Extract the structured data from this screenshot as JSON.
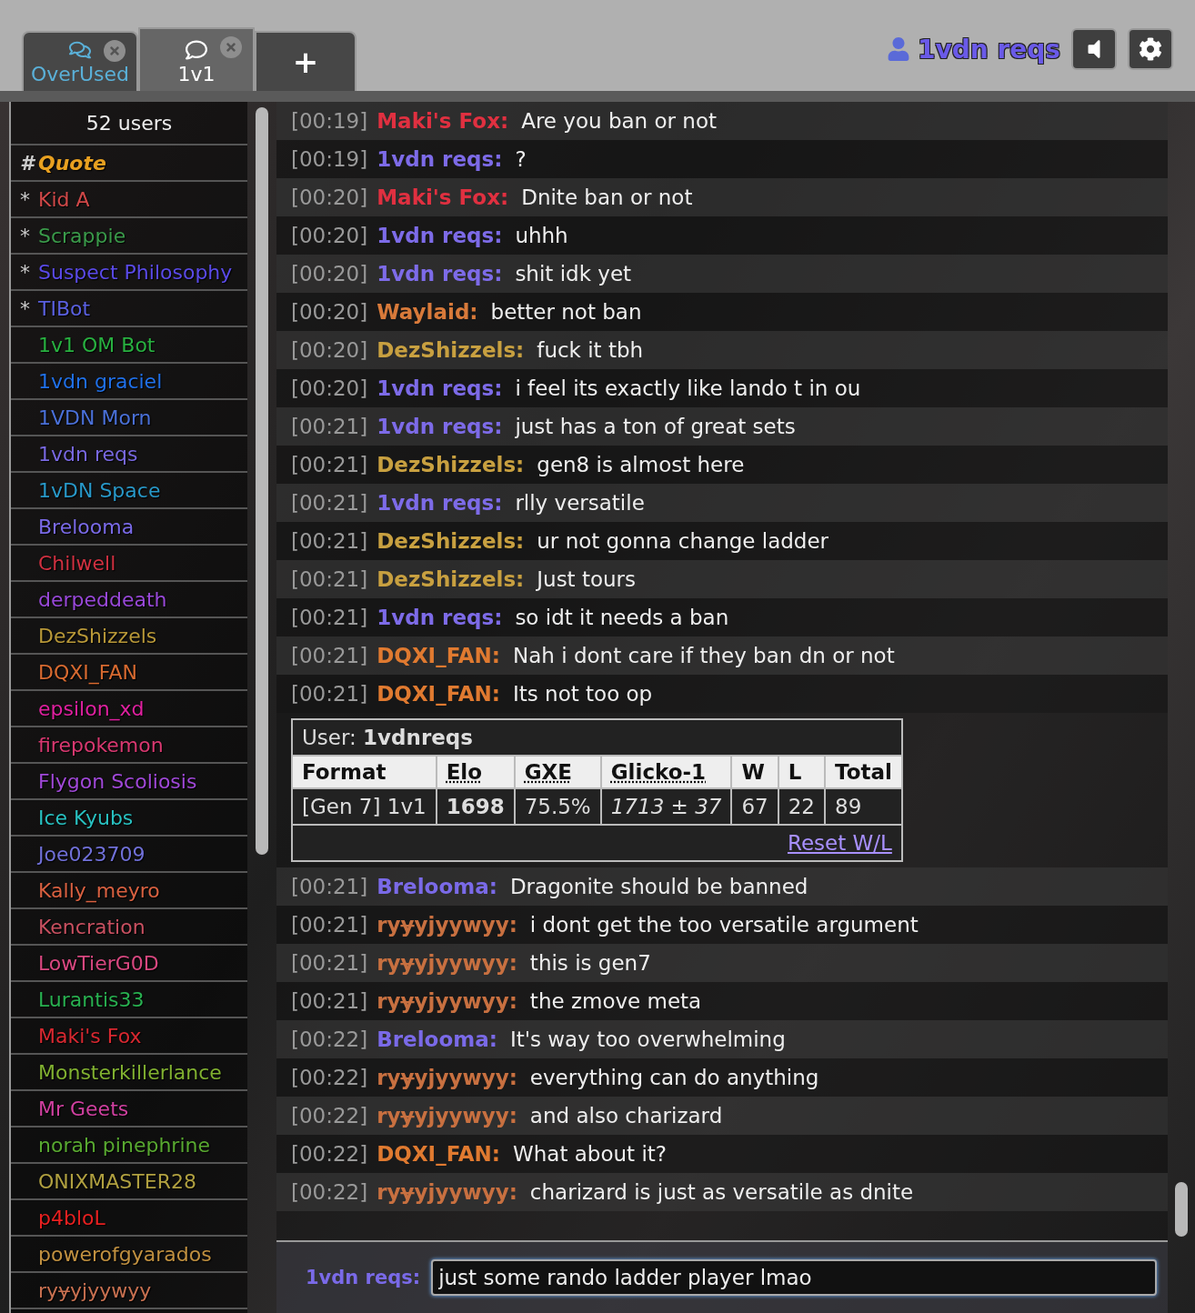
{
  "tabs": [
    {
      "label": "OverUsed",
      "selected": false
    },
    {
      "label": "1v1",
      "selected": true
    }
  ],
  "new_tab": {
    "label": "+"
  },
  "header": {
    "user": "1vdn reqs"
  },
  "userlist": {
    "count": "52 users",
    "users": [
      {
        "symbol": "#",
        "name": "Quote",
        "color": "#e8a020",
        "italic": true
      },
      {
        "symbol": "*",
        "name": "Kid A",
        "color": "#d04848",
        "italic": false
      },
      {
        "symbol": "*",
        "name": "Scrappie",
        "color": "#3a9a4a",
        "italic": false
      },
      {
        "symbol": "*",
        "name": "Suspect Philosophy",
        "color": "#5a4ae8",
        "italic": false
      },
      {
        "symbol": "*",
        "name": "TIBot",
        "color": "#5a60e0",
        "italic": false
      },
      {
        "name": "1v1 OM Bot",
        "color": "#28b040",
        "italic": false
      },
      {
        "name": "1vdn graciel",
        "color": "#2070e8",
        "italic": false
      },
      {
        "name": "1VDN Morn",
        "color": "#4a70d8",
        "italic": false
      },
      {
        "name": "1vdn reqs",
        "color": "#7868e0",
        "italic": false
      },
      {
        "name": "1vDN Space",
        "color": "#2898c8",
        "italic": false
      },
      {
        "name": "Brelooma",
        "color": "#7a6ae8",
        "italic": false
      },
      {
        "name": "Chilwell",
        "color": "#d03040",
        "italic": false
      },
      {
        "name": "derpeddeath",
        "color": "#9848d8",
        "italic": false
      },
      {
        "name": "DezShizzels",
        "color": "#b89838",
        "italic": false
      },
      {
        "name": "DQXI_FAN",
        "color": "#d86a30",
        "italic": false
      },
      {
        "name": "epsilon_xd",
        "color": "#e020a0",
        "italic": false
      },
      {
        "name": "firepokemon",
        "color": "#d83870",
        "italic": false
      },
      {
        "name": "Flygon Scoliosis",
        "color": "#a048d8",
        "italic": false
      },
      {
        "name": "Ice Kyubs",
        "color": "#28c0c0",
        "italic": false
      },
      {
        "name": "Joe023709",
        "color": "#7070d8",
        "italic": false
      },
      {
        "name": "Kally_meyro",
        "color": "#d86040",
        "italic": false
      },
      {
        "name": "Kencration",
        "color": "#c85060",
        "italic": false
      },
      {
        "name": "LowTierG0D",
        "color": "#d84880",
        "italic": false
      },
      {
        "name": "Lurantis33",
        "color": "#28b050",
        "italic": false
      },
      {
        "name": "Maki's Fox",
        "color": "#d82830",
        "italic": false
      },
      {
        "name": "Monsterkillerlance",
        "color": "#80b030",
        "italic": false
      },
      {
        "name": "Mr Geets",
        "color": "#d040a0",
        "italic": false
      },
      {
        "name": "norah pinephrine",
        "color": "#58a830",
        "italic": false
      },
      {
        "name": "ONIXMASTER28",
        "color": "#b0a040",
        "italic": false
      },
      {
        "name": "p4bloL",
        "color": "#e82020",
        "italic": false
      },
      {
        "name": "powerofgyarados",
        "color": "#c09040",
        "italic": false
      },
      {
        "name": "ryɏyjyywyy",
        "color": "#c87050",
        "italic": false
      }
    ]
  },
  "chat": [
    {
      "kind": "message",
      "time": "[00:19]",
      "name": "Maki's Fox:",
      "color": "#e03040",
      "text": "Are you ban or not"
    },
    {
      "kind": "message",
      "time": "[00:19]",
      "name": "1vdn reqs:",
      "color": "#7d6be8",
      "text": "?"
    },
    {
      "kind": "message",
      "time": "[00:20]",
      "name": "Maki's Fox:",
      "color": "#e03040",
      "text": "Dnite ban or not"
    },
    {
      "kind": "message",
      "time": "[00:20]",
      "name": "1vdn reqs:",
      "color": "#7d6be8",
      "text": "uhhh"
    },
    {
      "kind": "message",
      "time": "[00:20]",
      "name": "1vdn reqs:",
      "color": "#7d6be8",
      "text": "shit idk yet"
    },
    {
      "kind": "message",
      "time": "[00:20]",
      "name": "Waylaid:",
      "color": "#d87a3a",
      "text": "better not ban"
    },
    {
      "kind": "message",
      "time": "[00:20]",
      "name": "DezShizzels:",
      "color": "#c8a040",
      "text": "fuck it tbh"
    },
    {
      "kind": "message",
      "time": "[00:20]",
      "name": "1vdn reqs:",
      "color": "#7d6be8",
      "text": "i feel its exactly like lando t in ou"
    },
    {
      "kind": "message",
      "time": "[00:21]",
      "name": "1vdn reqs:",
      "color": "#7d6be8",
      "text": "just has a ton of great sets"
    },
    {
      "kind": "message",
      "time": "[00:21]",
      "name": "DezShizzels:",
      "color": "#c8a040",
      "text": "gen8 is almost here"
    },
    {
      "kind": "message",
      "time": "[00:21]",
      "name": "1vdn reqs:",
      "color": "#7d6be8",
      "text": "rlly versatile"
    },
    {
      "kind": "message",
      "time": "[00:21]",
      "name": "DezShizzels:",
      "color": "#c8a040",
      "text": "ur not gonna change ladder"
    },
    {
      "kind": "message",
      "time": "[00:21]",
      "name": "DezShizzels:",
      "color": "#c8a040",
      "text": "Just tours"
    },
    {
      "kind": "message",
      "time": "[00:21]",
      "name": "1vdn reqs:",
      "color": "#7d6be8",
      "text": "so idt it needs a ban"
    },
    {
      "kind": "message",
      "time": "[00:21]",
      "name": "DQXI_FAN:",
      "color": "#e07a30",
      "text": "Nah i dont care if they ban dn or not"
    },
    {
      "kind": "message",
      "time": "[00:21]",
      "name": "DQXI_FAN:",
      "color": "#e07a30",
      "text": "Its not too op"
    },
    {
      "kind": "rank_table",
      "user_label": "User:",
      "user": "1vdnreqs",
      "columns": [
        {
          "label": "Format",
          "dotted": false
        },
        {
          "label": "Elo",
          "dotted": true
        },
        {
          "label": "GXE",
          "dotted": true
        },
        {
          "label": "Glicko-1",
          "dotted": true
        },
        {
          "label": "W",
          "dotted": false
        },
        {
          "label": "L",
          "dotted": false
        },
        {
          "label": "Total",
          "dotted": false
        }
      ],
      "cells": [
        "[Gen 7] 1v1",
        "1698",
        "75.5%",
        "1713 ± 37",
        "67",
        "22",
        "89"
      ],
      "link": "Reset W/L"
    },
    {
      "kind": "message",
      "time": "[00:21]",
      "name": "Brelooma:",
      "color": "#7a6ae8",
      "text": "Dragonite should be banned"
    },
    {
      "kind": "message",
      "time": "[00:21]",
      "name": "ryɏyjyywyy:",
      "color": "#c87040",
      "text": "i dont get the too versatile argument"
    },
    {
      "kind": "message",
      "time": "[00:21]",
      "name": "ryɏyjyywyy:",
      "color": "#c87040",
      "text": "this is gen7"
    },
    {
      "kind": "message",
      "time": "[00:21]",
      "name": "ryɏyjyywyy:",
      "color": "#c87040",
      "text": "the zmove meta"
    },
    {
      "kind": "message",
      "time": "[00:22]",
      "name": "Brelooma:",
      "color": "#7a6ae8",
      "text": "It's way too overwhelming"
    },
    {
      "kind": "message",
      "time": "[00:22]",
      "name": "ryɏyjyywyy:",
      "color": "#c87040",
      "text": "everything can do anything"
    },
    {
      "kind": "message",
      "time": "[00:22]",
      "name": "ryɏyjyywyy:",
      "color": "#c87040",
      "text": "and also charizard"
    },
    {
      "kind": "message",
      "time": "[00:22]",
      "name": "DQXI_FAN:",
      "color": "#e07a30",
      "text": "What about it?"
    },
    {
      "kind": "message",
      "time": "[00:22]",
      "name": "ryɏyjyywyy:",
      "color": "#c87040",
      "text": "charizard is just as versatile as dnite"
    }
  ],
  "composer": {
    "label": "1vdn reqs:",
    "value": "just some rando ladder player lmao"
  }
}
